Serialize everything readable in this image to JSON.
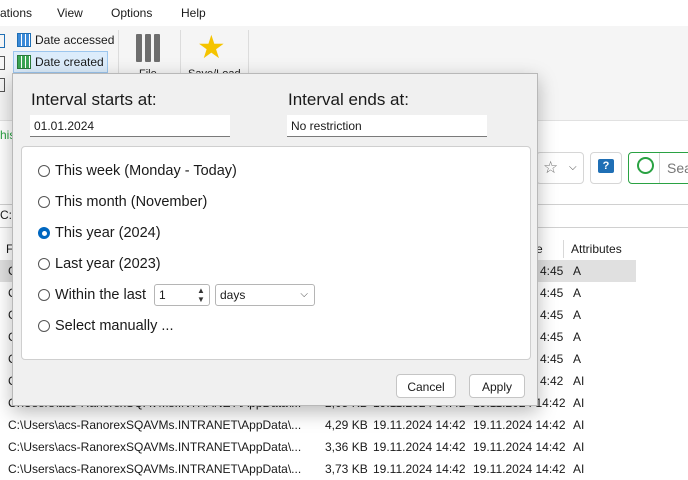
{
  "menu": {
    "items": [
      "ations",
      "View",
      "Options",
      "Help"
    ]
  },
  "ribbon": {
    "date_accessed": "Date accessed",
    "date_created": "Date created",
    "file_label": "File",
    "saveload_label": "Save/Load"
  },
  "background": {
    "left_snippet": "his",
    "search_placeholder": "Sea",
    "path_prefix": "C:",
    "col_first": "F",
    "col_date": "e",
    "col_attributes": "Attributes",
    "rows": [
      {
        "path": "C",
        "size": "",
        "d1": "",
        "d2": "4:45",
        "attr": "A",
        "hl": true
      },
      {
        "path": "C",
        "size": "",
        "d1": "",
        "d2": "4:45",
        "attr": "A",
        "hl": false
      },
      {
        "path": "C",
        "size": "",
        "d1": "",
        "d2": "4:45",
        "attr": "A",
        "hl": false
      },
      {
        "path": "C",
        "size": "",
        "d1": "",
        "d2": "4:45",
        "attr": "A",
        "hl": false
      },
      {
        "path": "C",
        "size": "",
        "d1": "",
        "d2": "4:45",
        "attr": "A",
        "hl": false
      },
      {
        "path": "C",
        "size": "",
        "d1": "",
        "d2": "4:42",
        "attr": "AI",
        "hl": false
      },
      {
        "path": "C:\\Users\\acs-RanorexSQAVMs.INTRANET\\AppData\\...",
        "size": "2,05 KB",
        "d1": "19.11.2024 14:42",
        "d2": "19.11.2024 14:42",
        "attr": "AI",
        "hl": false
      },
      {
        "path": "C:\\Users\\acs-RanorexSQAVMs.INTRANET\\AppData\\...",
        "size": "4,29 KB",
        "d1": "19.11.2024 14:42",
        "d2": "19.11.2024 14:42",
        "attr": "AI",
        "hl": false
      },
      {
        "path": "C:\\Users\\acs-RanorexSQAVMs.INTRANET\\AppData\\...",
        "size": "3,36 KB",
        "d1": "19.11.2024 14:42",
        "d2": "19.11.2024 14:42",
        "attr": "AI",
        "hl": false
      },
      {
        "path": "C:\\Users\\acs-RanorexSQAVMs.INTRANET\\AppData\\...",
        "size": "3,73 KB",
        "d1": "19.11.2024 14:42",
        "d2": "19.11.2024 14:42",
        "attr": "AI",
        "hl": false
      }
    ]
  },
  "dialog": {
    "starts_label": "Interval starts at:",
    "starts_value": "01.01.2024",
    "ends_label": "Interval ends at:",
    "ends_value": "No restriction",
    "options": [
      {
        "label": "This week (Monday - Today)",
        "selected": false
      },
      {
        "label": "This month (November)",
        "selected": false
      },
      {
        "label": "This year (2024)",
        "selected": true
      },
      {
        "label": "Last year (2023)",
        "selected": false
      },
      {
        "label": "Within the last",
        "selected": false
      },
      {
        "label": "Select manually ...",
        "selected": false
      }
    ],
    "within_value": "1",
    "within_unit": "days",
    "cancel_label": "Cancel",
    "apply_label": "Apply"
  },
  "colors": {
    "accent": "#0067c0",
    "star": "#f5c400",
    "green": "#2aa243"
  }
}
